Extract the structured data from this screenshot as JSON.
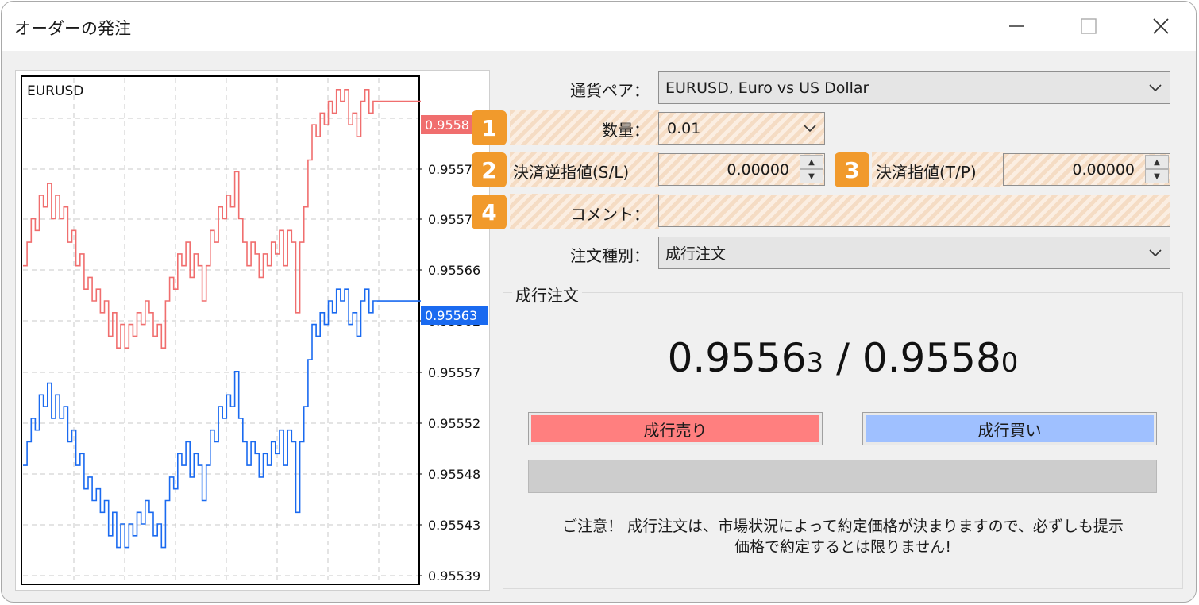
{
  "window": {
    "title": "オーダーの発注"
  },
  "chart": {
    "symbol": "EURUSD",
    "bid_tag": "0.95563",
    "ask_tag": "0.9558",
    "price_labels": [
      "0.9557",
      "0.95571",
      "0.95566",
      "0.95562",
      "0.95557",
      "0.95552",
      "0.95548",
      "0.95543",
      "0.95539"
    ],
    "colors": {
      "ask": "#f06e6e",
      "bid": "#1a6af0",
      "bid_tag_bg": "#1a6af0",
      "ask_tag_bg": "#f06e6e"
    }
  },
  "chart_data": {
    "type": "line",
    "title": "EURUSD",
    "series": [
      {
        "name": "Ask",
        "values": [
          0.95566,
          0.95568,
          0.9557,
          0.95569,
          0.95572,
          0.95571,
          0.95573,
          0.9557,
          0.95572,
          0.9557,
          0.95571,
          0.95568,
          0.95569,
          0.95566,
          0.95567,
          0.95564,
          0.95565,
          0.95563,
          0.95564,
          0.95562,
          0.95563,
          0.9556,
          0.95562,
          0.95559,
          0.95561,
          0.95559,
          0.95561,
          0.9556,
          0.95562,
          0.95561,
          0.95563,
          0.95562,
          0.9556,
          0.95561,
          0.95559,
          0.95563,
          0.95565,
          0.95564,
          0.95567,
          0.95566,
          0.95568,
          0.95565,
          0.95567,
          0.95566,
          0.95563,
          0.95566,
          0.95569,
          0.95568,
          0.95571,
          0.9557,
          0.95572,
          0.95571,
          0.95574,
          0.9557,
          0.95568,
          0.95566,
          0.95568,
          0.95567,
          0.95565,
          0.95567,
          0.95566,
          0.95568,
          0.95567,
          0.95569,
          0.95566,
          0.95569,
          0.95568,
          0.95562,
          0.95568,
          0.95571,
          0.95575,
          0.95578,
          0.95577,
          0.95579,
          0.95578,
          0.9558,
          0.95579,
          0.95581,
          0.9558,
          0.95581,
          0.95578,
          0.95579,
          0.95577,
          0.9558,
          0.95581,
          0.95579,
          0.9558,
          0.9558
        ]
      },
      {
        "name": "Bid",
        "values": [
          0.95549,
          0.95551,
          0.95553,
          0.95552,
          0.95555,
          0.95554,
          0.95556,
          0.95553,
          0.95555,
          0.95553,
          0.95554,
          0.95551,
          0.95552,
          0.95549,
          0.9555,
          0.95547,
          0.95548,
          0.95546,
          0.95547,
          0.95545,
          0.95546,
          0.95543,
          0.95545,
          0.95542,
          0.95544,
          0.95542,
          0.95544,
          0.95543,
          0.95545,
          0.95544,
          0.95546,
          0.95545,
          0.95543,
          0.95544,
          0.95542,
          0.95546,
          0.95548,
          0.95547,
          0.9555,
          0.95549,
          0.95551,
          0.95548,
          0.9555,
          0.95549,
          0.95546,
          0.95549,
          0.95552,
          0.95551,
          0.95554,
          0.95553,
          0.95555,
          0.95554,
          0.95557,
          0.95553,
          0.95551,
          0.95549,
          0.95551,
          0.9555,
          0.95548,
          0.9555,
          0.95549,
          0.95551,
          0.9555,
          0.95552,
          0.95549,
          0.95552,
          0.95551,
          0.95545,
          0.95551,
          0.95554,
          0.95558,
          0.95561,
          0.9556,
          0.95562,
          0.95561,
          0.95563,
          0.95562,
          0.95564,
          0.95563,
          0.95564,
          0.95561,
          0.95562,
          0.9556,
          0.95563,
          0.95564,
          0.95562,
          0.95563,
          0.95563
        ]
      }
    ],
    "ylim": [
      0.95539,
      0.95582
    ],
    "y_ticks": [
      0.9557,
      0.95571,
      0.95566,
      0.95562,
      0.95557,
      0.95552,
      0.95548,
      0.95543,
      0.95539
    ],
    "grid": true
  },
  "form": {
    "pair_label": "通貨ペア：",
    "pair_value": "EURUSD, Euro vs US Dollar",
    "volume_label": "数量：",
    "volume_value": "0.01",
    "sl_label": "決済逆指値(S/L)",
    "sl_value": "0.00000",
    "tp_label": "決済指値(T/P)",
    "tp_value": "0.00000",
    "comment_label": "コメント：",
    "comment_value": "",
    "type_label": "注文種別：",
    "type_value": "成行注文"
  },
  "badges": {
    "b1": "1",
    "b2": "2",
    "b3": "3",
    "b4": "4"
  },
  "market": {
    "group_title": "成行注文",
    "bid_main": "0.9556",
    "bid_small": "3",
    "separator": " / ",
    "ask_main": "0.9558",
    "ask_small": "0",
    "sell_label": "成行売り",
    "buy_label": "成行買い",
    "sell_color": "#ff7f7f",
    "buy_color": "#9fc0ff",
    "notice_line1": "ご注意！ 成行注文は、市場状況によって約定価格が決まりますので、必ずしも提示",
    "notice_line2": "価格で約定するとは限りません!"
  }
}
